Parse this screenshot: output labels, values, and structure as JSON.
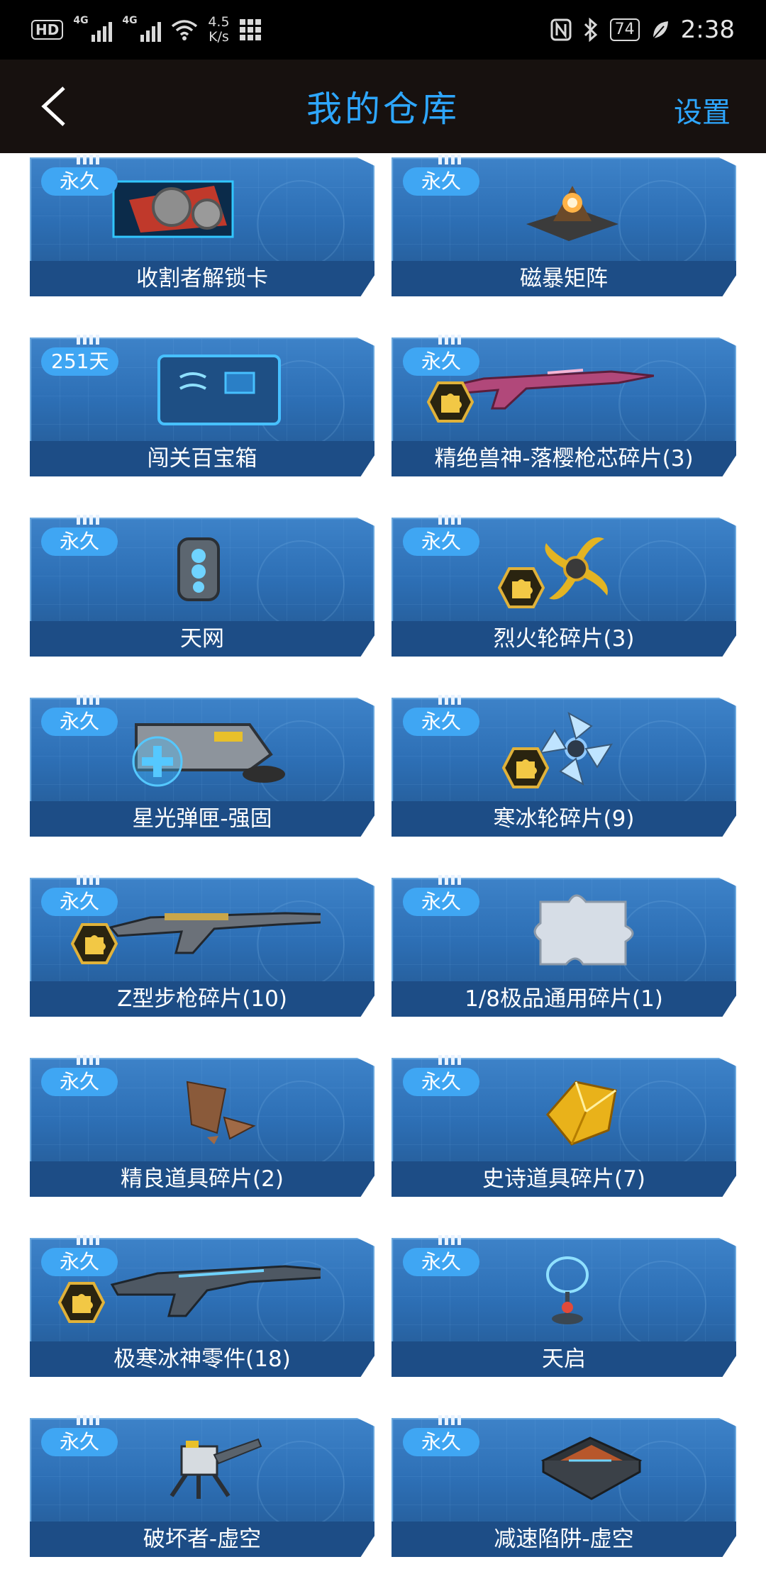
{
  "status_bar": {
    "hd": "HD",
    "net1": "4G",
    "net2": "4G",
    "speed_value": "4.5",
    "speed_unit": "K/s",
    "battery": "74",
    "time": "2:38"
  },
  "header": {
    "title": "我的仓库",
    "settings_label": "设置"
  },
  "items": [
    {
      "badge": "永久",
      "label": "收割者解锁卡",
      "icon": "card-icon",
      "piece": false
    },
    {
      "badge": "永久",
      "label": "磁暴矩阵",
      "icon": "tesla-matrix-icon",
      "piece": false
    },
    {
      "badge": "251天",
      "label": "闯关百宝箱",
      "icon": "treasure-box-icon",
      "piece": false
    },
    {
      "badge": "永久",
      "label": "精绝兽神-落樱枪芯碎片(3)",
      "icon": "rifle-icon",
      "piece": true
    },
    {
      "badge": "永久",
      "label": "天网",
      "icon": "skynet-device-icon",
      "piece": false
    },
    {
      "badge": "永久",
      "label": "烈火轮碎片(3)",
      "icon": "fire-wheel-icon",
      "piece": true
    },
    {
      "badge": "永久",
      "label": "星光弹匣-强固",
      "icon": "magazine-icon",
      "piece": false
    },
    {
      "badge": "永久",
      "label": "寒冰轮碎片(9)",
      "icon": "ice-wheel-icon",
      "piece": true
    },
    {
      "badge": "永久",
      "label": "Z型步枪碎片(10)",
      "icon": "z-rifle-icon",
      "piece": true
    },
    {
      "badge": "永久",
      "label": "1/8极品通用碎片(1)",
      "icon": "puzzle-piece-icon",
      "piece": false
    },
    {
      "badge": "永久",
      "label": "精良道具碎片(2)",
      "icon": "fine-fragment-icon",
      "piece": false
    },
    {
      "badge": "永久",
      "label": "史诗道具碎片(7)",
      "icon": "epic-fragment-icon",
      "piece": false
    },
    {
      "badge": "永久",
      "label": "极寒冰神零件(18)",
      "icon": "ice-god-gun-icon",
      "piece": true
    },
    {
      "badge": "永久",
      "label": "天启",
      "icon": "apocalypse-icon",
      "piece": false
    },
    {
      "badge": "永久",
      "label": "破坏者-虚空",
      "icon": "destroyer-icon",
      "piece": false
    },
    {
      "badge": "永久",
      "label": "减速陷阱-虚空",
      "icon": "slow-trap-icon",
      "piece": false
    }
  ]
}
